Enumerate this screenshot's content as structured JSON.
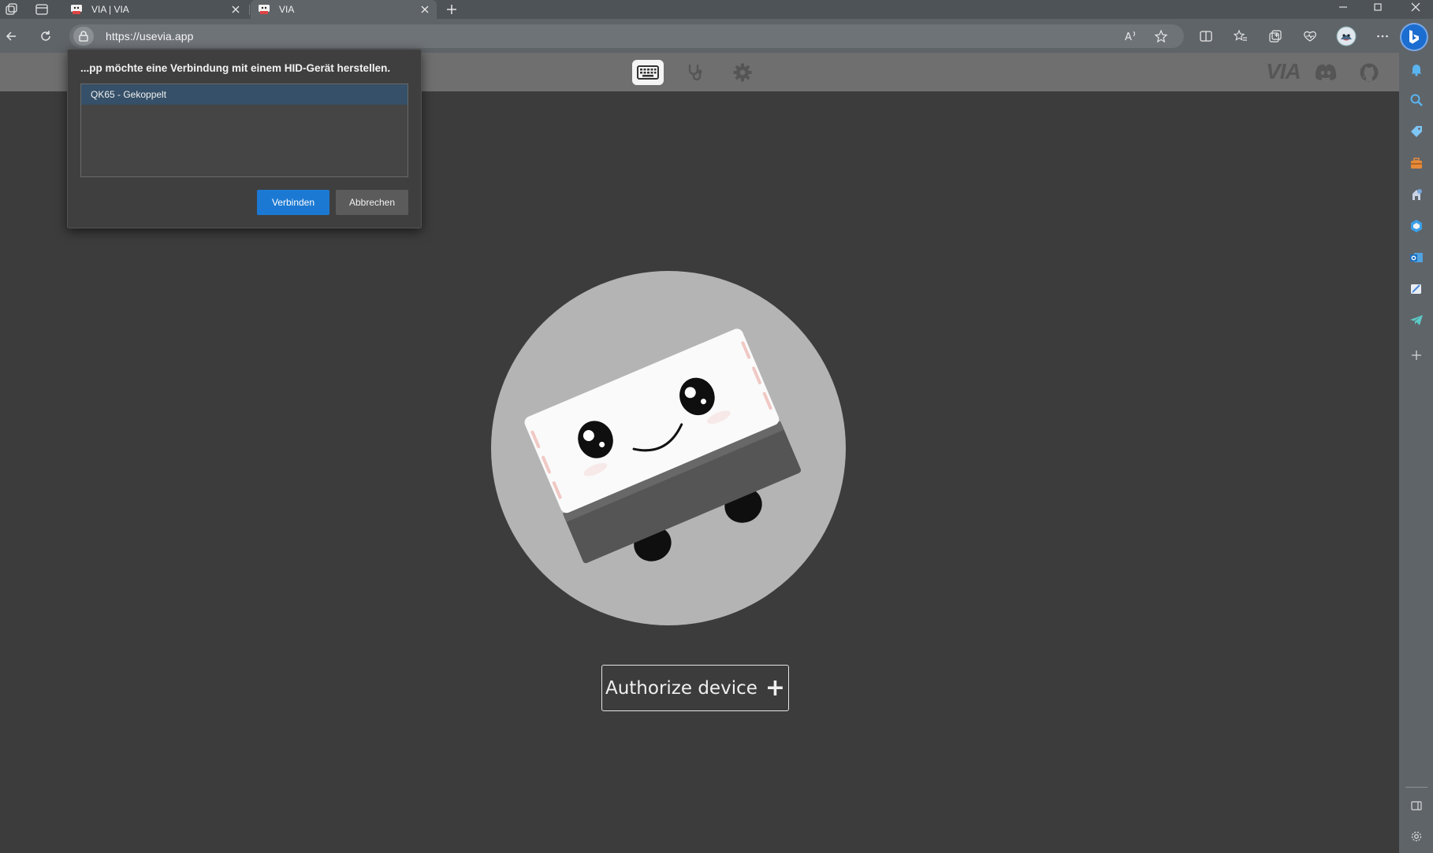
{
  "browser": {
    "tabs": [
      {
        "title": "VIA | VIA",
        "active": false
      },
      {
        "title": "VIA",
        "active": true
      }
    ],
    "url": "https://usevia.app",
    "icons": {
      "workspaces": "workspaces-icon",
      "tab_actions": "tab-actions-icon",
      "new_tab": "plus-icon",
      "back": "back-arrow-icon",
      "refresh": "refresh-icon",
      "site_info": "lock-icon",
      "read_aloud": "read-aloud-icon",
      "favorite": "star-icon",
      "split_screen": "split-screen-icon",
      "favorites": "favorites-icon",
      "collections": "collections-icon",
      "browser_essentials": "heart-pulse-icon",
      "profile": "profile-avatar",
      "more": "ellipsis-icon",
      "copilot": "bing-icon"
    },
    "sidebar_icons": [
      "notification-bell-icon",
      "search-icon",
      "shopping-tag-icon",
      "tools-briefcase-icon",
      "games-icon",
      "microsoft-365-icon",
      "outlook-icon",
      "drop-icon",
      "telegram-icon",
      "add-icon",
      "hide-sidebar-icon",
      "sidebar-settings-icon"
    ]
  },
  "app": {
    "header": {
      "nav": [
        {
          "name": "configure",
          "icon": "keyboard-icon",
          "active": true
        },
        {
          "name": "test",
          "icon": "stethoscope-icon",
          "active": false
        },
        {
          "name": "settings",
          "icon": "gear-icon",
          "active": false
        }
      ],
      "logo_text": "VIA",
      "right_icons": [
        "discord-icon",
        "github-icon"
      ]
    },
    "authorize_label": "Authorize device",
    "authorize_icon": "+"
  },
  "hid_dialog": {
    "title": "...pp möchte eine Verbindung mit einem HID-Gerät herstellen.",
    "devices": [
      {
        "label": "QK65 - Gekoppelt",
        "selected": true
      }
    ],
    "connect_label": "Verbinden",
    "cancel_label": "Abbrechen"
  },
  "colors": {
    "accent": "#1c79d3",
    "selected_row": "#355068",
    "app_background": "#3c3c3c",
    "app_header": "#6f6f6f",
    "mascot_circle": "#b4b4b4"
  }
}
